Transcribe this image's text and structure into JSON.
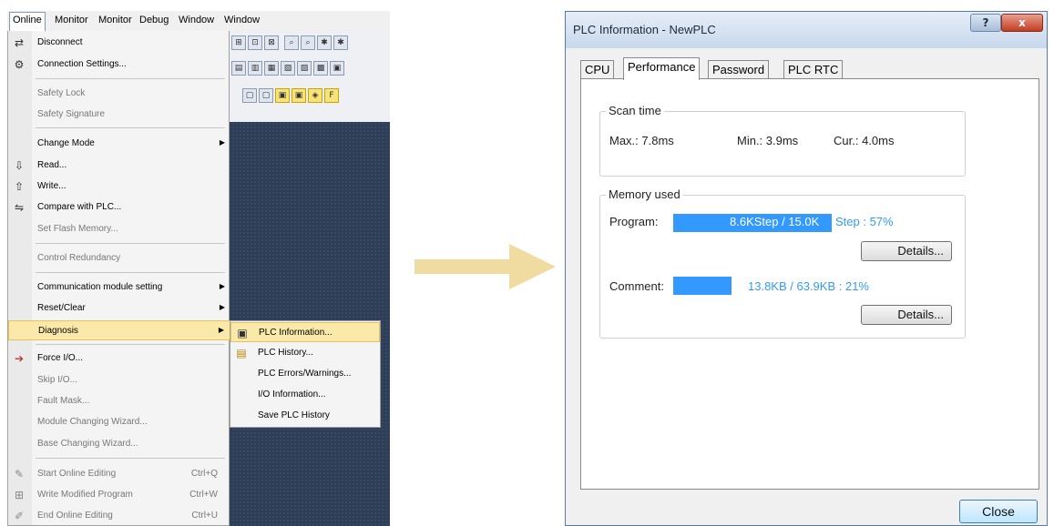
{
  "menubar": {
    "items": [
      "Online",
      "Monitor",
      "Monitor",
      "Debug",
      "Window",
      "Window"
    ]
  },
  "online_menu": {
    "items": [
      {
        "label": "Disconnect",
        "icon": "disconnect-icon",
        "enabled": true
      },
      {
        "label": "Connection Settings...",
        "icon": "connection-settings-icon",
        "enabled": true
      },
      {
        "label": "Safety Lock",
        "enabled": false
      },
      {
        "label": "Safety Signature",
        "enabled": false
      },
      {
        "label": "Change Mode",
        "enabled": true,
        "submenu": true
      },
      {
        "label": "Read...",
        "icon": "read-icon",
        "enabled": true
      },
      {
        "label": "Write...",
        "icon": "write-icon",
        "enabled": true
      },
      {
        "label": "Compare with PLC...",
        "icon": "compare-icon",
        "enabled": true
      },
      {
        "label": "Set Flash Memory...",
        "enabled": false
      },
      {
        "label": "Control Redundancy",
        "enabled": false
      },
      {
        "label": "Communication module setting",
        "enabled": true,
        "submenu": true
      },
      {
        "label": "Reset/Clear",
        "enabled": true,
        "submenu": true
      },
      {
        "label": "Diagnosis",
        "enabled": true,
        "submenu": true,
        "selected": true
      },
      {
        "label": "Force I/O...",
        "icon": "force-io-icon",
        "enabled": true
      },
      {
        "label": "Skip I/O...",
        "enabled": false
      },
      {
        "label": "Fault Mask...",
        "enabled": false
      },
      {
        "label": "Module Changing Wizard...",
        "enabled": false
      },
      {
        "label": "Base Changing Wizard...",
        "enabled": false
      },
      {
        "label": "Start Online Editing",
        "shortcut": "Ctrl+Q",
        "icon": "start-edit-icon",
        "enabled": false
      },
      {
        "label": "Write Modified Program",
        "shortcut": "Ctrl+W",
        "icon": "write-modified-icon",
        "enabled": false
      },
      {
        "label": "End Online Editing",
        "shortcut": "Ctrl+U",
        "icon": "end-edit-icon",
        "enabled": false
      }
    ]
  },
  "diagnosis_submenu": {
    "items": [
      {
        "label": "PLC Information...",
        "icon": "plc-information-icon",
        "selected": true
      },
      {
        "label": "PLC History...",
        "icon": "plc-history-icon"
      },
      {
        "label": "PLC Errors/Warnings..."
      },
      {
        "label": "I/O Information..."
      },
      {
        "label": "Save PLC History"
      }
    ]
  },
  "dialog": {
    "title": "PLC Information - NewPLC",
    "help_button": "?",
    "close_x": "x",
    "tabs": [
      "CPU",
      "Performance",
      "Password",
      "PLC RTC"
    ],
    "active_tab": "Performance",
    "scan_time": {
      "title": "Scan time",
      "max": "Max.: 7.8ms",
      "min": "Min.: 3.9ms",
      "cur": "Cur.: 4.0ms"
    },
    "memory": {
      "title": "Memory used",
      "program_label": "Program:",
      "program_text_a": "8.6KStep / 15.0K",
      "program_text_b": "Step : 57%",
      "program_fraction": 0.57,
      "comment_label": "Comment:",
      "comment_text": "13.8KB / 63.9KB : 21%",
      "comment_fraction": 0.21,
      "details_label": "Details..."
    },
    "close_button": "Close"
  },
  "colors": {
    "accent": "#3399ff",
    "arrow": "#f0dca0"
  }
}
